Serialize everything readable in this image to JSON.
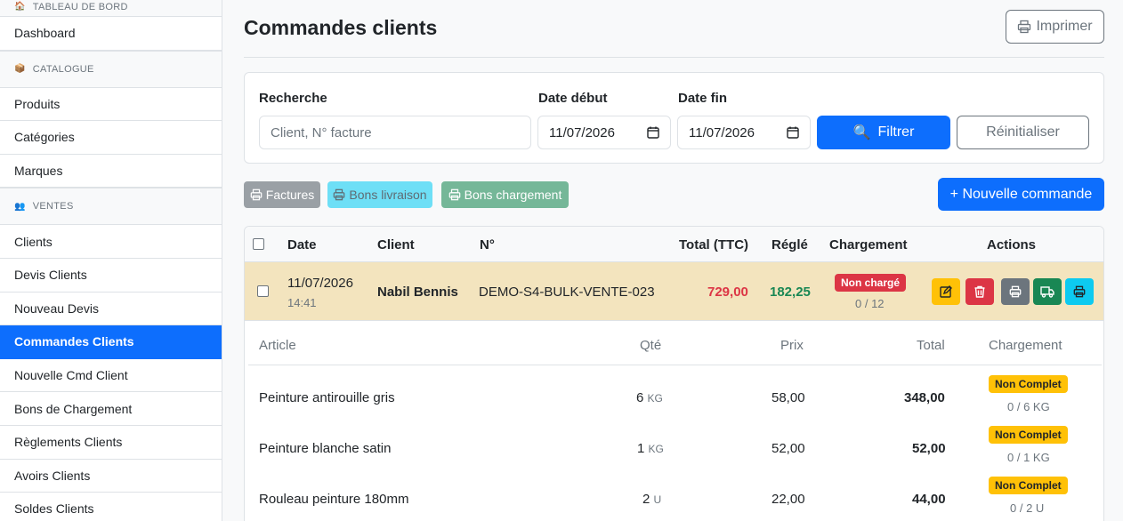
{
  "sidebar": {
    "sections": [
      {
        "title": "TABLEAU DE BORD",
        "icon": "home-icon"
      },
      {
        "title": "CATALOGUE",
        "icon": "box-icon"
      },
      {
        "title": "VENTES",
        "icon": "users-icon"
      }
    ],
    "dashboard": "Dashboard",
    "catalogue_items": [
      "Produits",
      "Catégories",
      "Marques"
    ],
    "ventes_items": [
      "Clients",
      "Devis Clients",
      "Nouveau Devis",
      "Commandes Clients",
      "Nouvelle Cmd Client",
      "Bons de Chargement",
      "Règlements Clients",
      "Avoirs Clients",
      "Soldes Clients"
    ],
    "active": "Commandes Clients"
  },
  "page": {
    "title": "Commandes clients",
    "print_label": "Imprimer"
  },
  "filters": {
    "search_label": "Recherche",
    "search_placeholder": "Client, N° facture",
    "start_label": "Date début",
    "start_value": "11/07/2026",
    "end_label": "Date fin",
    "end_value": "11/07/2026",
    "filter_label": "Filtrer",
    "reset_label": "Réinitialiser"
  },
  "doc_buttons": {
    "factures": "Factures",
    "bons_livraison": "Bons livraison",
    "bons_chargement": "Bons chargement"
  },
  "new_order_label": "+ Nouvelle commande",
  "table": {
    "headers": [
      "Date",
      "Client",
      "N°",
      "Total (TTC)",
      "Réglé",
      "Chargement",
      "Actions"
    ],
    "order": {
      "date": "11/07/2026",
      "time": "14:41",
      "client": "Nabil Bennis",
      "number": "DEMO-S4-BULK-VENTE-023",
      "total": "729,00",
      "paid": "182,25",
      "loading_badge": "Non chargé",
      "loading_progress": "0 / 12"
    },
    "sub_headers": [
      "Article",
      "Qté",
      "Prix",
      "Total",
      "Chargement"
    ],
    "articles": [
      {
        "name": "Peinture antirouille gris",
        "qty": "6",
        "unit": "KG",
        "price": "58,00",
        "total": "348,00",
        "badge": "Non Complet",
        "progress": "0 / 6 KG"
      },
      {
        "name": "Peinture blanche satin",
        "qty": "1",
        "unit": "KG",
        "price": "52,00",
        "total": "52,00",
        "badge": "Non Complet",
        "progress": "0 / 1 KG"
      },
      {
        "name": "Rouleau peinture 180mm",
        "qty": "2",
        "unit": "U",
        "price": "22,00",
        "total": "44,00",
        "badge": "Non Complet",
        "progress": "0 / 2 U"
      }
    ]
  },
  "colors": {
    "primary": "#0d6efd",
    "danger": "#dc3545",
    "success": "#198754",
    "warning": "#ffc107",
    "row_highlight": "#f3e4be"
  }
}
